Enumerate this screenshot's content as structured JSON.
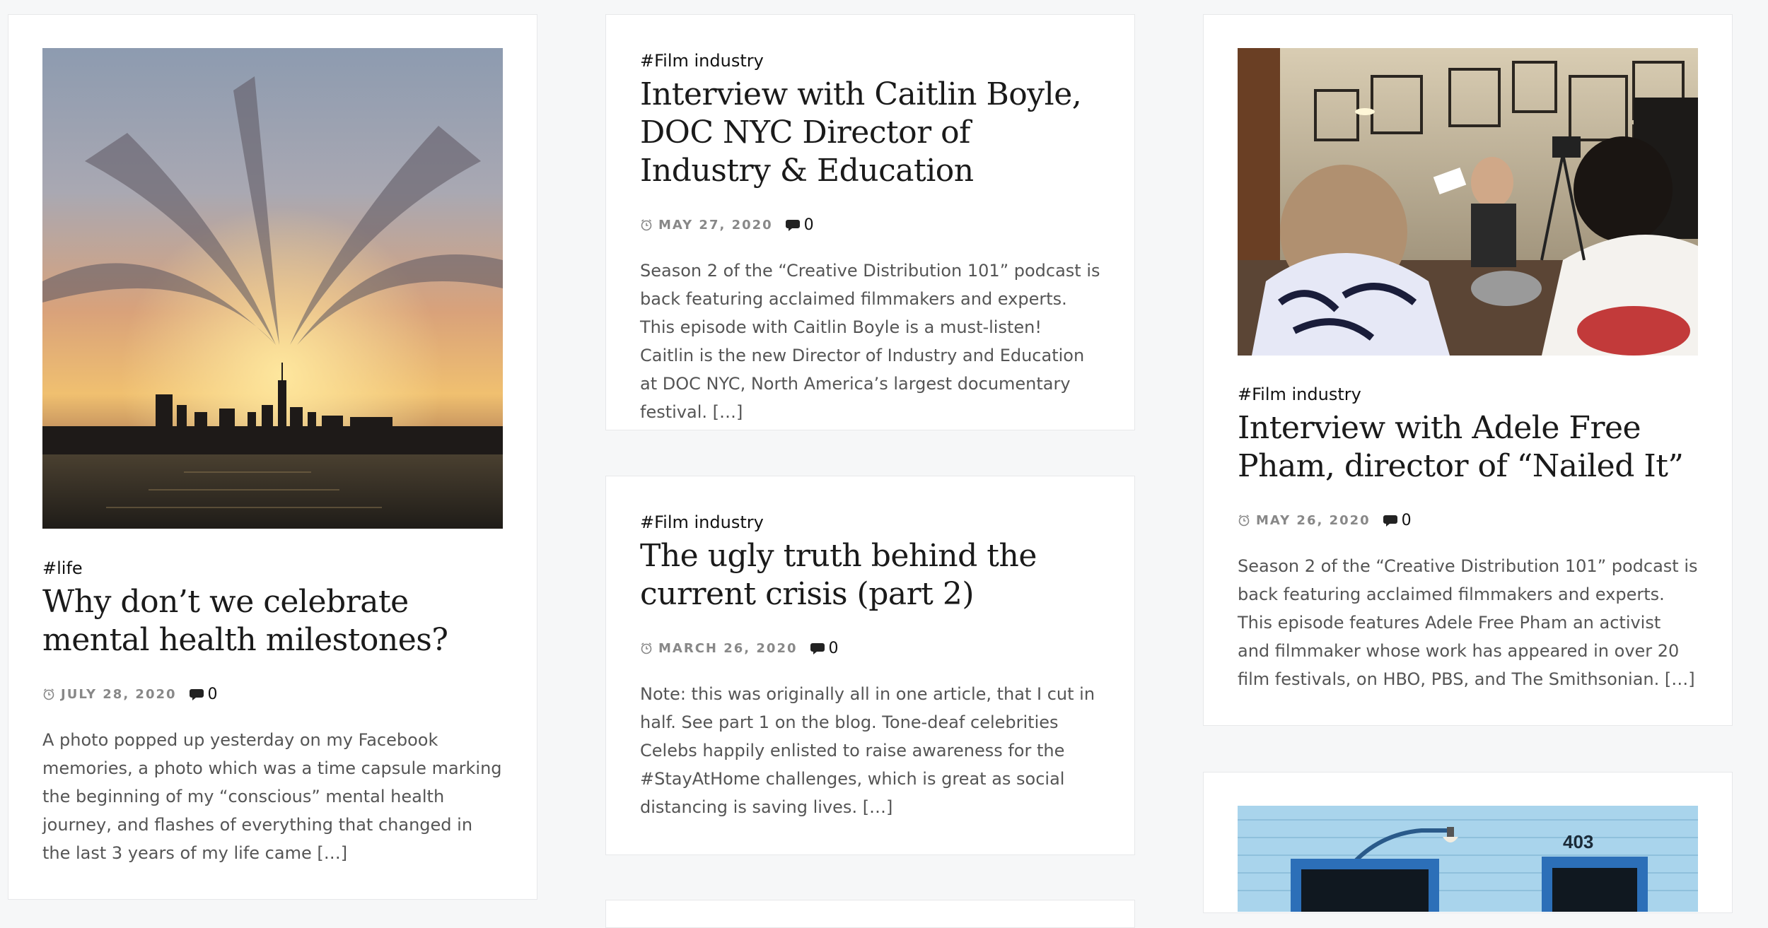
{
  "posts": [
    {
      "category": "#life",
      "title": "Why don’t we celebrate mental health milestones?",
      "date": "JULY 28, 2020",
      "comments": "0",
      "excerpt": "A photo popped up yesterday on my Facebook memories, a photo which was a time capsule marking the beginning of my “conscious” mental health journey, and flashes of everything that changed in the last 3 years of my life came […]",
      "image": "sunset-city-skyline-photo"
    },
    {
      "category": "#Film industry",
      "title": "Interview with Caitlin Boyle, DOC NYC Director of Industry & Education",
      "date": "MAY 27, 2020",
      "comments": "0",
      "excerpt": "Season 2 of the “Creative Distribution 101” podcast is back featuring acclaimed filmmakers and experts. This episode with Caitlin Boyle is a must-listen! Caitlin is the new Director of Industry and Education at DOC NYC, North America’s largest documentary festival. […]"
    },
    {
      "category": "#Film industry",
      "title": "The ugly truth behind the current crisis (part 2)",
      "date": "MARCH 26, 2020",
      "comments": "0",
      "excerpt": "Note: this was originally all in one article, that I cut in half. See part 1 on the blog. Tone-deaf celebrities Celebs happily enlisted to raise awareness for the #StayAtHome challenges, which is great as social distancing is saving lives. […]"
    },
    {
      "category": "#Film industry",
      "title": "Interview with Adele Free Pham, director of “Nailed It”",
      "date": "MAY 26, 2020",
      "comments": "0",
      "excerpt": "Season 2 of the “Creative Distribution 101” podcast is back featuring acclaimed filmmakers and experts. This episode features Adele Free Pham an activist and filmmaker whose work has appeared in over 20 film festivals, on HBO, PBS, and The Smithsonian. […]",
      "image": "film-set-interview-photo"
    },
    {
      "image": "blue-brick-building-photo",
      "image_text": "403"
    }
  ]
}
